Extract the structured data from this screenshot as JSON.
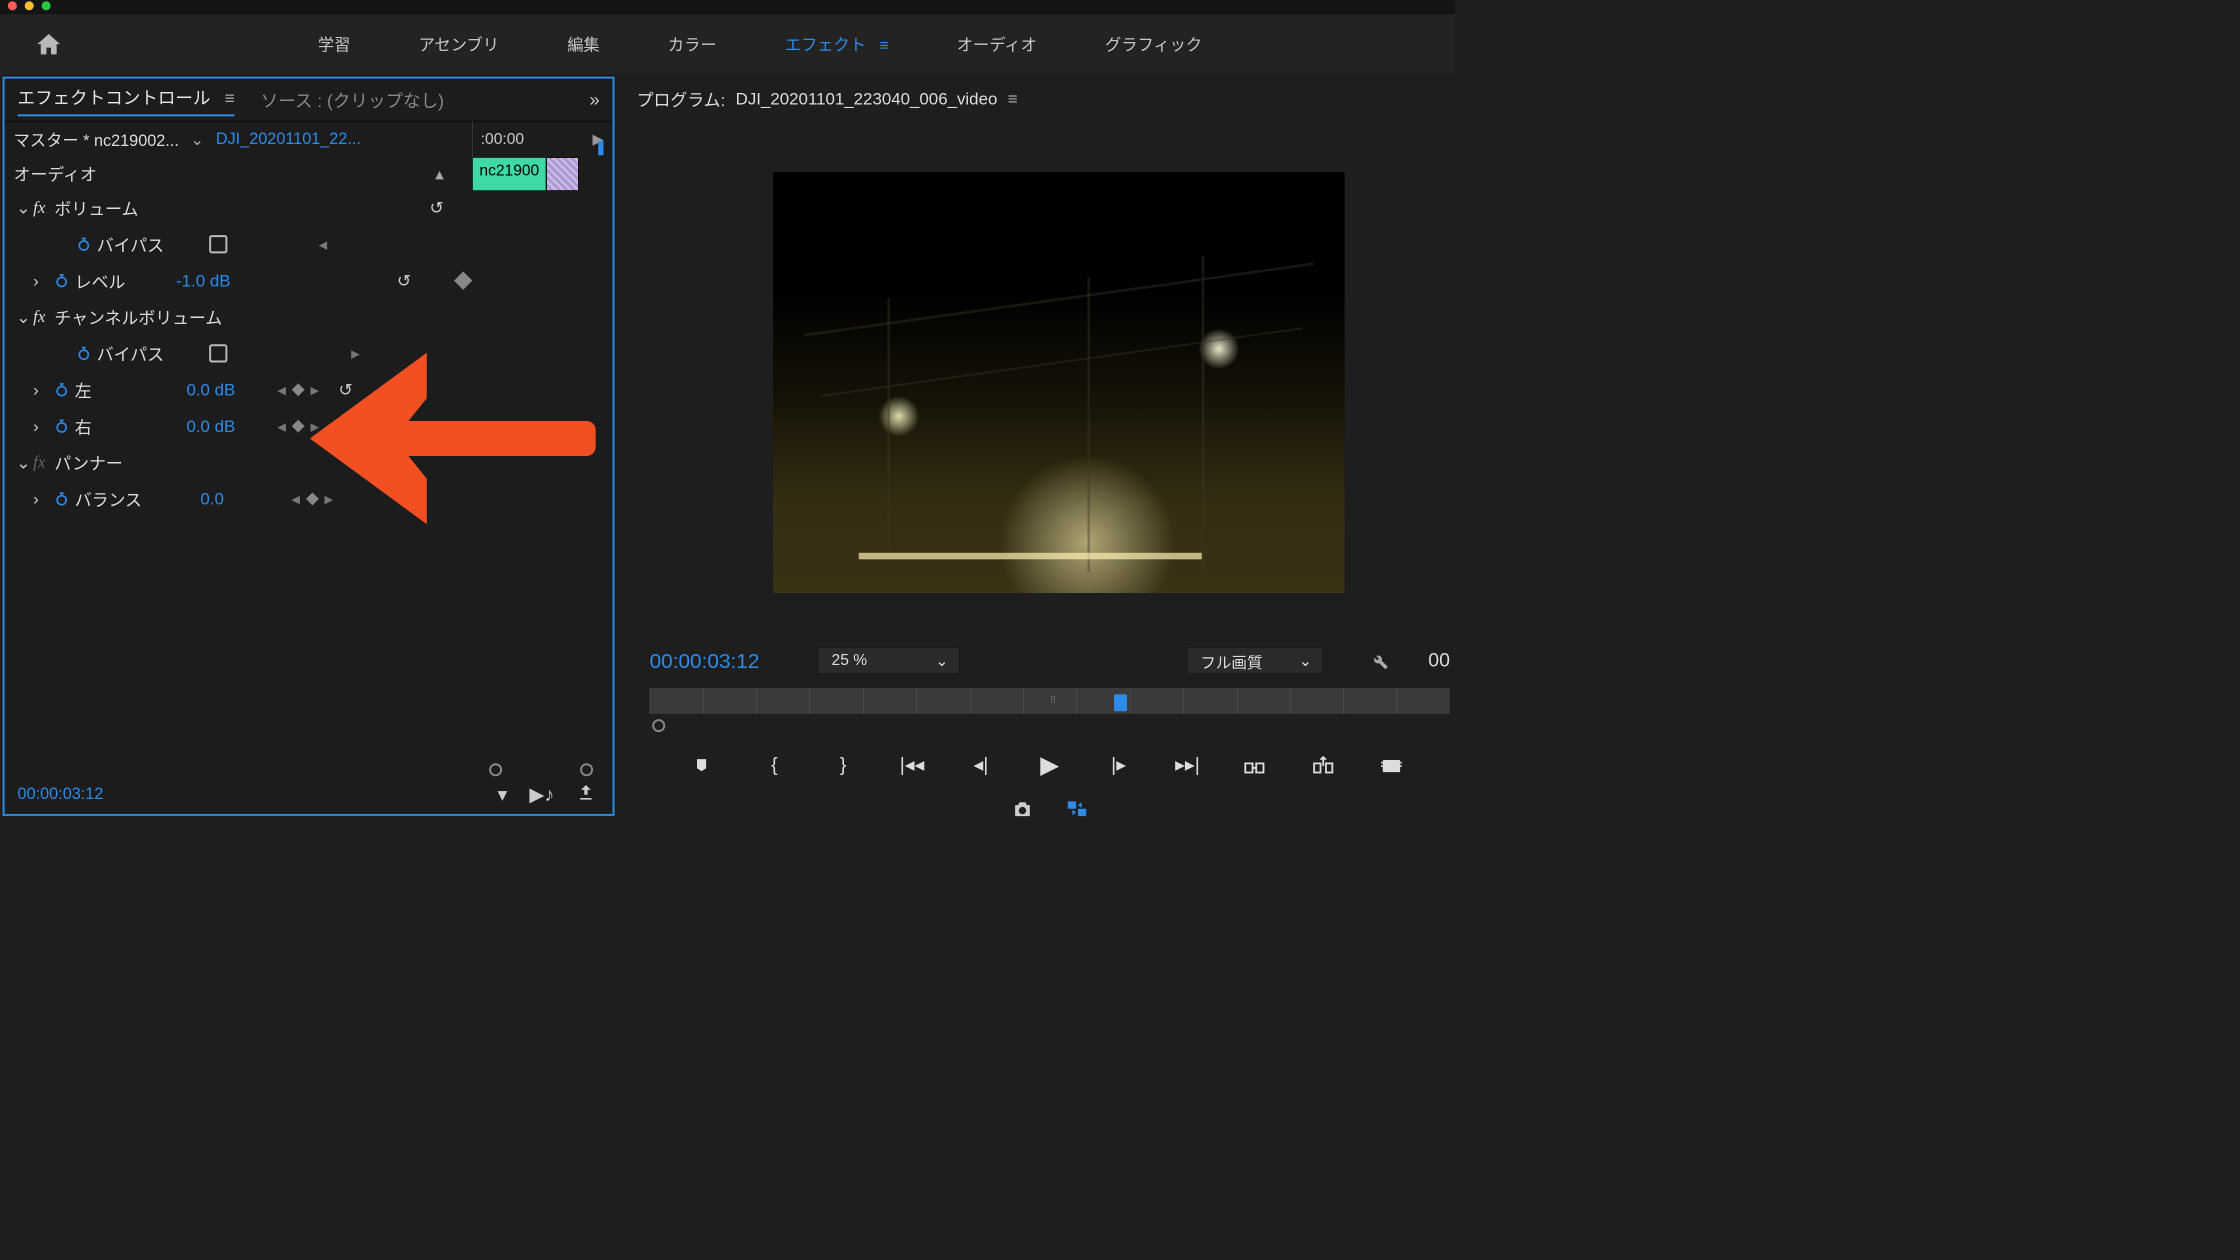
{
  "topnav": {
    "tabs": [
      "学習",
      "アセンブリ",
      "編集",
      "カラー",
      "エフェクト",
      "オーディオ",
      "グラフィック"
    ],
    "active_index": 4
  },
  "effect_controls": {
    "panel_tab_active": "エフェクトコントロール",
    "panel_tab_inactive": "ソース : (クリップなし)",
    "master_label": "マスター * nc219002...",
    "sequence_label": "DJI_20201101_22...",
    "mini_timeline": {
      "start": ":00:00",
      "clip": "nc21900"
    },
    "section": "オーディオ",
    "volume": {
      "title": "ボリューム",
      "bypass_label": "バイパス",
      "level_label": "レベル",
      "level_value": "-1.0 dB"
    },
    "channel_volume": {
      "title": "チャンネルボリューム",
      "bypass_label": "バイパス",
      "left_label": "左",
      "left_value": "0.0 dB",
      "right_label": "右",
      "right_value": "0.0 dB"
    },
    "panner": {
      "title": "パンナー",
      "balance_label": "バランス",
      "balance_value": "0.0"
    },
    "footer_timecode": "00:00:03:12"
  },
  "program_monitor": {
    "title_prefix": "プログラム:",
    "title_seq": "DJI_20201101_223040_006_video",
    "timecode": "00:00:03:12",
    "zoom": "25 %",
    "quality": "フル画質",
    "timecode_right": "00"
  }
}
